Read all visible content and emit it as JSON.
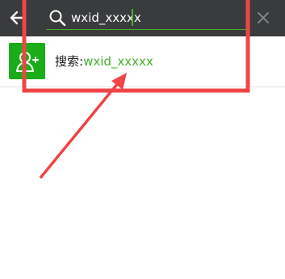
{
  "search": {
    "query": "wxid_xxxxx"
  },
  "result": {
    "prefix": "搜索:",
    "query": "wxid_xxxxx"
  },
  "colors": {
    "topbar": "#3a3b3d",
    "accent": "#46b02e",
    "icon_bg": "#1aad19",
    "annotation": "#f04447"
  },
  "icons": {
    "back": "arrow-left-icon",
    "search": "search-icon",
    "clear": "close-icon",
    "add_friend": "add-friend-icon"
  }
}
